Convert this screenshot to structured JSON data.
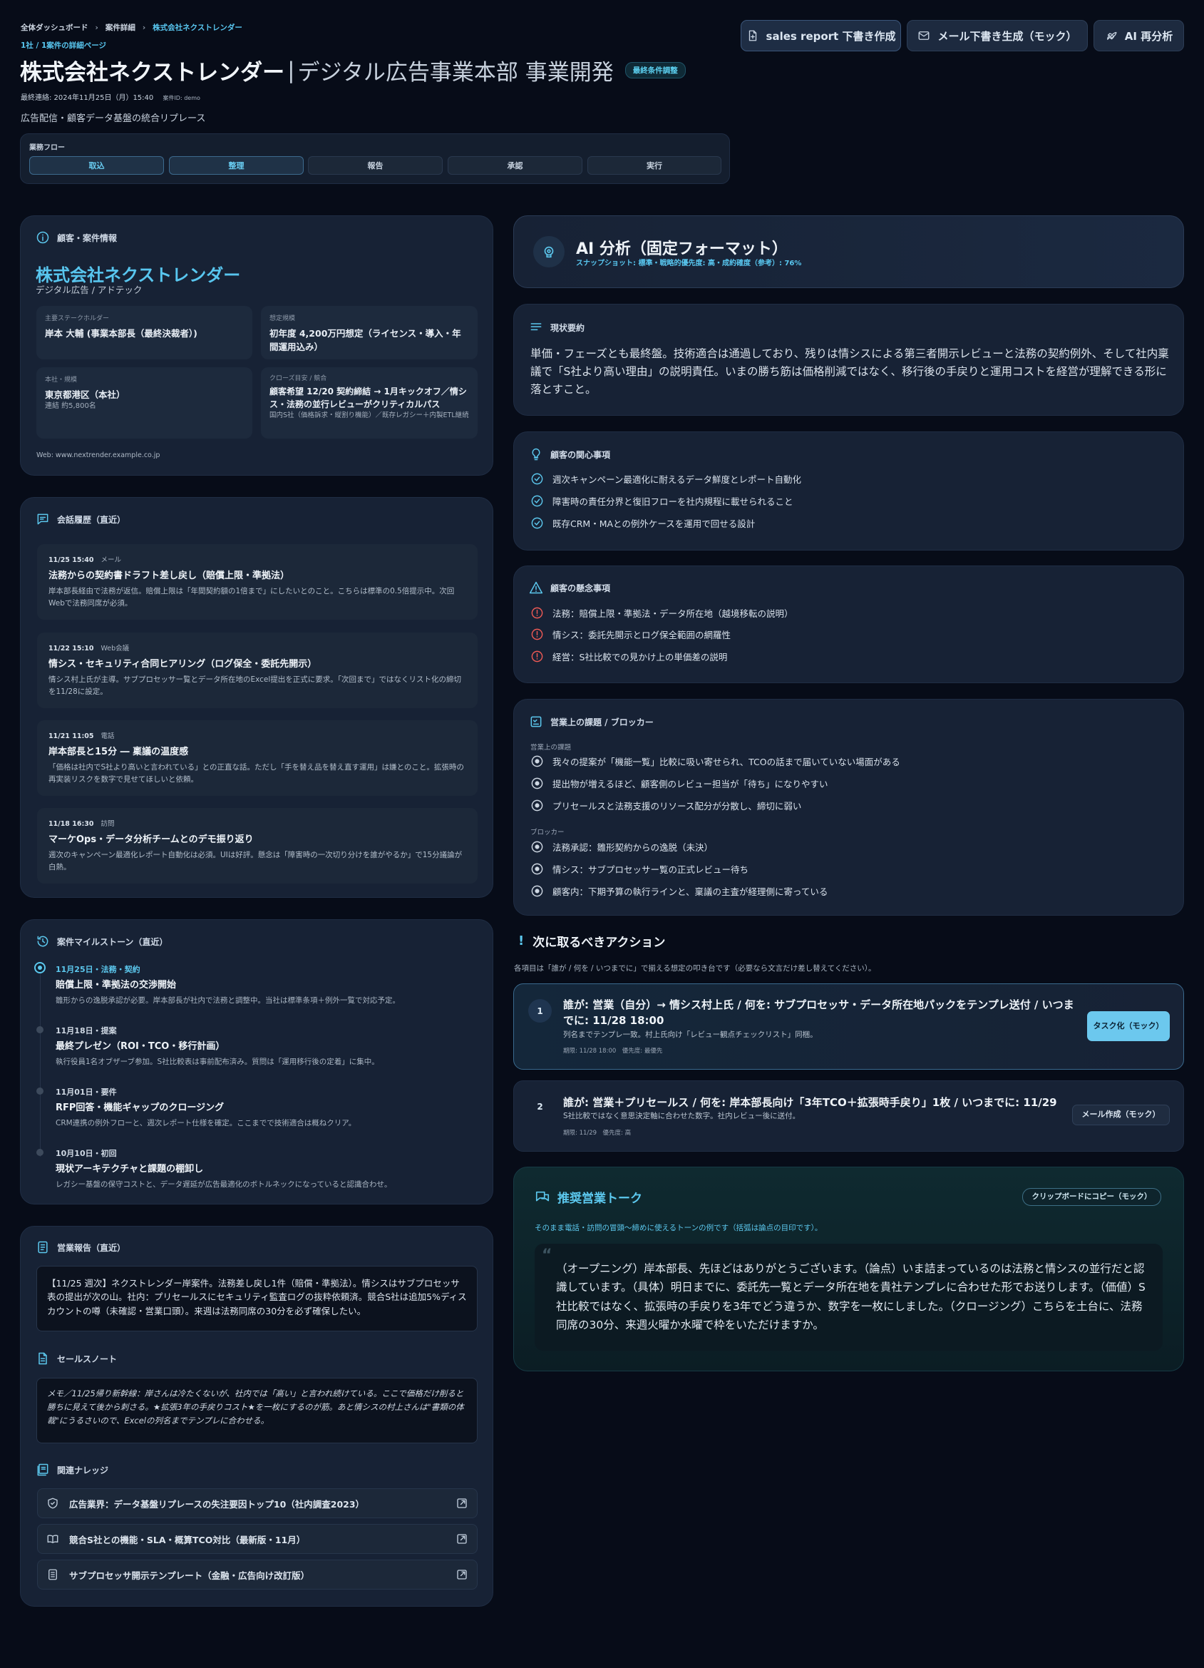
{
  "breadcrumb": {
    "items": [
      "全体ダッシュボード",
      "案件詳細",
      "株式会社ネクストレンダー"
    ],
    "subtitle": "1社 / 1案件の詳細ページ"
  },
  "header": {
    "company": "株式会社ネクストレンダー",
    "division": "デジタル広告事業本部 事業開発",
    "status_badge": "最終条件調整",
    "last_contact": "最終連絡: 2024年11月25日（月）15:40",
    "case_id": "案件ID: demo",
    "description": "広告配信・顧客データ基盤の統合リプレース"
  },
  "toolbar": {
    "sales_report": "sales report 下書き作成",
    "mail_draft": "メール下書き生成（モック）",
    "ai_reanalyze": "AI 再分析"
  },
  "flow": {
    "label": "業務フロー",
    "steps": [
      "取込",
      "整理",
      "報告",
      "承認",
      "実行"
    ],
    "active_steps": [
      0,
      1
    ]
  },
  "customer": {
    "section_title": "顧客・案件情報",
    "name": "株式会社ネクストレンダー",
    "industry": "デジタル広告 / アドテック",
    "stakeholder_label": "主要ステークホルダー",
    "stakeholder_value": "岸本 大輔 (事業本部長（最終決裁者）)",
    "scale_label": "想定規模",
    "scale_value": "初年度 4,200万円想定（ライセンス・導入・年間運用込み）",
    "hq_label": "本社・規模",
    "hq_value": "東京都港区（本社）",
    "hq_sub": "連結 約5,800名",
    "close_label": "クローズ目安 / 競合",
    "close_value": "顧客希望 12/20 契約締結 → 1月キックオフ／情シス・法務の並行レビューがクリティカルパス",
    "close_sub": "国内S社（価格訴求・縦割り機能）／既存レガシー＋内製ETL継続",
    "web": "Web: www.nextrender.example.co.jp"
  },
  "conversations": {
    "section_title": "会話履歴（直近）",
    "items": [
      {
        "time": "11/25 15:40",
        "channel": "メール",
        "title": "法務からの契約書ドラフト差し戻し（賠償上限・準拠法）",
        "body": "岸本部長経由で法務が返信。賠償上限は「年間契約額の1倍まで」にしたいとのこと。こちらは標準の0.5倍提示中。次回Webで法務同席が必須。"
      },
      {
        "time": "11/22 15:10",
        "channel": "Web会議",
        "title": "情シス・セキュリティ合同ヒアリング（ログ保全・委託先開示）",
        "body": "情シス村上氏が主導。サブプロセッサー覧とデータ所在地のExcel提出を正式に要求。「次回まで」ではなくリスト化の締切を11/28に設定。"
      },
      {
        "time": "11/21 11:05",
        "channel": "電話",
        "title": "岸本部長と15分 ― 稟議の温度感",
        "body": "「価格は社内でS社より高いと言われている」との正直な話。ただし「手を替え品を替え直す運用」は嫌とのこと。拡張時の再実装リスクを数字で見せてほしいと依頼。"
      },
      {
        "time": "11/18 16:30",
        "channel": "訪問",
        "title": "マーケOps・データ分析チームとのデモ振り返り",
        "body": "週次のキャンペーン最適化レポート自動化は必須。UIは好評。懸念は「障害時の一次切り分けを誰がやるか」で15分議論が白熱。"
      }
    ]
  },
  "milestones": {
    "section_title": "案件マイルストーン（直近）",
    "items": [
      {
        "date": "11月25日・法務・契約",
        "title": "賠償上限・準拠法の交渉開始",
        "body": "雛形からの逸脱承認が必要。岸本部長が社内で法務と調整中。当社は標準条項＋例外一覧で対応予定。"
      },
      {
        "date": "11月18日・提案",
        "title": "最終プレゼン（ROI・TCO・移行計画）",
        "body": "執行役員1名オブザーブ参加。S社比較表は事前配布済み。質問は「運用移行後の定着」に集中。"
      },
      {
        "date": "11月01日・要件",
        "title": "RFP回答・機能ギャップのクロージング",
        "body": "CRM連携の例外フローと、週次レポート仕様を確定。ここまでで技術適合は概ねクリア。"
      },
      {
        "date": "10月10日・初回",
        "title": "現状アーキテクチャと課題の棚卸し",
        "body": "レガシー基盤の保守コストと、データ遅延が広告最適化のボトルネックになっていると認識合わせ。"
      }
    ]
  },
  "sales_report": {
    "section_title": "営業報告（直近）",
    "body": "【11/25 週次】ネクストレンダー岸案件。法務差し戻し1件（賠償・準拠法）。情シスはサブプロセッサ表の提出が次の山。社内：プリセールスにセキュリティ監査ログの抜粋依頼済。競合S社は追加5%ディスカウントの噂（未確認・営業口頭）。来週は法務同席の30分を必ず確保したい。"
  },
  "sales_note": {
    "section_title": "セールスノート",
    "body": "メモ／11/25帰り新幹線：岸さんは冷たくないが、社内では「高い」と言われ続けている。ここで価格だけ削ると勝ちに見えて後から刺さる。★拡張3年の手戻りコスト★を一枚にするのが筋。あと情シスの村上さんは\"書類の体裁\"にうるさいので、Excelの列名までテンプレに合わせる。"
  },
  "knowledge": {
    "section_title": "関連ナレッジ",
    "items": [
      {
        "icon": "shield-icon",
        "label": "広告業界：データ基盤リプレースの失注要因トップ10（社内調査2023）"
      },
      {
        "icon": "book-icon",
        "label": "競合S社との機能・SLA・概算TCO対比（最新版・11月）"
      },
      {
        "icon": "document-icon",
        "label": "サブプロセッサ開示テンプレート（金融・広告向け改訂版）"
      }
    ]
  },
  "ai": {
    "title": "AI 分析（固定フォーマット）",
    "snapshot": "スナップショット: 標準・戦略的優先度: 高・成約確度（参考）: 76%"
  },
  "summary": {
    "section_title": "現状要約",
    "body": "単価・フェーズとも最終盤。技術適合は通過しており、残りは情シスによる第三者開示レビューと法務の契約例外、そして社内稟議で「S社より高い理由」の説明責任。いまの勝ち筋は価格削減ではなく、移行後の手戻りと運用コストを経営が理解できる形に落とすこと。"
  },
  "interests": {
    "section_title": "顧客の関心事項",
    "items": [
      "週次キャンペーン最適化に耐えるデータ鮮度とレポート自動化",
      "障害時の責任分界と復旧フローを社内規程に載せられること",
      "既存CRM・MAとの例外ケースを運用で回せる設計"
    ]
  },
  "concerns": {
    "section_title": "顧客の懸念事項",
    "items": [
      "法務：賠償上限・準拠法・データ所在地（越境移転の説明）",
      "情シス：委託先開示とログ保全範囲の網羅性",
      "経営：S社比較での見かけ上の単価差の説明"
    ]
  },
  "issues": {
    "section_title": "営業上の課題 / ブロッカー",
    "issues_label": "営業上の課題",
    "issues": [
      "我々の提案が「機能一覧」比較に吸い寄せられ、TCOの話まで届いていない場面がある",
      "提出物が増えるほど、顧客側のレビュー担当が「待ち」になりやすい",
      "プリセールスと法務支援のリソース配分が分散し、締切に弱い"
    ],
    "blockers_label": "ブロッカー",
    "blockers": [
      "法務承認：雛形契約からの逸脱（未決）",
      "情シス：サブプロセッサー覧の正式レビュー待ち",
      "顧客内：下期予算の執行ラインと、稟議の主査が経理側に寄っている"
    ]
  },
  "actions": {
    "title": "次に取るべきアクション",
    "note": "各項目は「誰が / 何を / いつまでに」で揃える想定の叩き台です（必要なら文言だけ差し替えてください）。",
    "items": [
      {
        "num": "1",
        "title": "誰が: 営業（自分）→ 情シス村上氏 / 何を: サブプロセッサ・データ所在地パックをテンプレ送付 / いつまでに: 11/28 18:00",
        "desc": "列名までテンプレ一致。村上氏向け「レビュー観点チェックリスト」同梱。",
        "meta": "期限: 11/28 18:00　優先度: 最優先",
        "button": "タスク化（モック）"
      },
      {
        "num": "2",
        "title": "誰が: 営業＋プリセールス / 何を: 岸本部長向け「3年TCO＋拡張時手戻り」1枚 / いつまでに: 11/29",
        "desc": "S社比較ではなく意思決定軸に合わせた数字。社内レビュー後に送付。",
        "meta": "期限: 11/29　優先度: 高",
        "button": "メール作成（モック）"
      }
    ]
  },
  "talk": {
    "title": "推奨営業トーク",
    "copy_button": "クリップボードにコピー（モック）",
    "note": "そのまま電話・訪問の冒頭〜締めに使えるトーンの例です（括弧は論点の目印です）。",
    "body": "（オープニング）岸本部長、先ほどはありがとうございます。（論点）いま詰まっているのは法務と情シスの並行だと認識しています。（具体）明日までに、委託先一覧とデータ所在地を貴社テンプレに合わせた形でお送りします。（価値）S社比較ではなく、拡張時の手戻りを3年でどう違うか、数字を一枚にしました。（クロージング）こちらを土台に、法務同席の30分、来週火曜か水曜で枠をいただけますか。"
  },
  "colors": {
    "background": "#070c18",
    "panel": "#172235",
    "accent": "#58c6ef",
    "warning": "#ef5a55"
  }
}
